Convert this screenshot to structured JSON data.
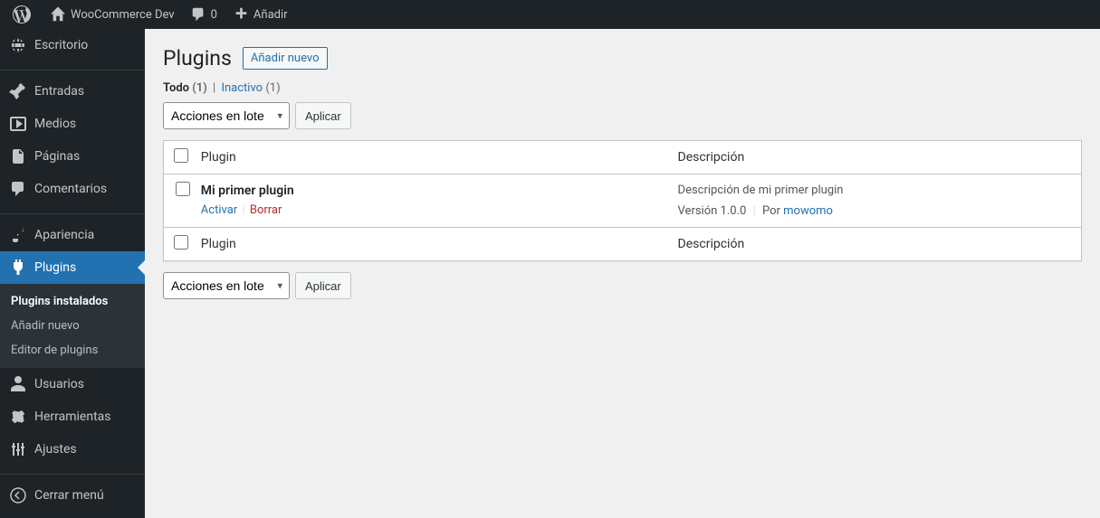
{
  "toolbar": {
    "site_name": "WooCommerce Dev",
    "comments_count": "0",
    "add_new": "Añadir"
  },
  "sidebar": {
    "dashboard": "Escritorio",
    "posts": "Entradas",
    "media": "Medios",
    "pages": "Páginas",
    "comments": "Comentarios",
    "appearance": "Apariencia",
    "plugins": "Plugins",
    "users": "Usuarios",
    "tools": "Herramientas",
    "settings": "Ajustes",
    "collapse": "Cerrar menú",
    "submenu": {
      "installed": "Plugins instalados",
      "add_new": "Añadir nuevo",
      "editor": "Editor de plugins"
    }
  },
  "page": {
    "title": "Plugins",
    "add_new": "Añadir nuevo"
  },
  "filters": {
    "all_label": "Todo",
    "all_count": "(1)",
    "inactive_label": "Inactivo",
    "inactive_count": "(1)"
  },
  "bulk": {
    "select_label": "Acciones en lote",
    "apply": "Aplicar"
  },
  "table": {
    "col_plugin": "Plugin",
    "col_description": "Descripción"
  },
  "plugins": [
    {
      "name": "Mi primer plugin",
      "activate": "Activar",
      "delete": "Borrar",
      "description": "Descripción de mi primer plugin",
      "version_label": "Versión 1.0.0",
      "by_label": "Por",
      "author": "mowomo"
    }
  ]
}
